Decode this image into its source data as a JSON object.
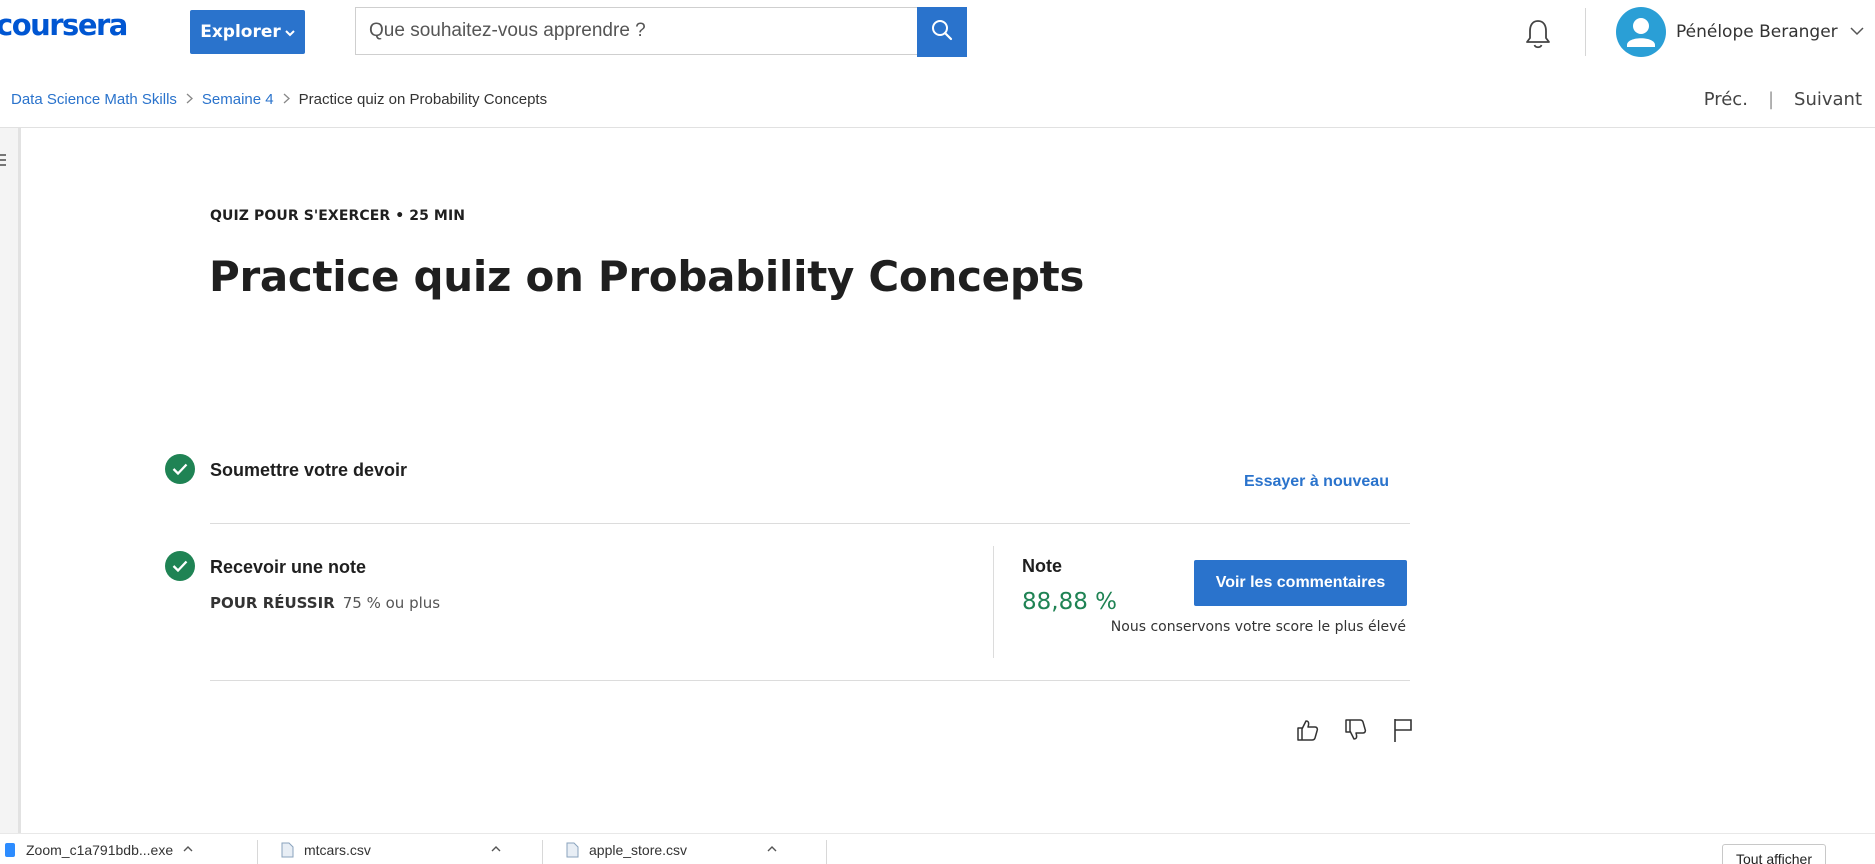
{
  "header": {
    "logo_text": "coursera",
    "explore_label": "Explorer",
    "search_placeholder": "Que souhaitez-vous apprendre ?",
    "user_name": "Pénélope Beranger"
  },
  "breadcrumb": {
    "items": [
      "Data Science Math Skills",
      "Semaine 4"
    ],
    "current": "Practice quiz on Probability Concepts"
  },
  "pager": {
    "prev": "Préc.",
    "next": "Suivant"
  },
  "quiz": {
    "eyebrow": "QUIZ POUR S'EXERCER • 25  MIN",
    "title": "Practice quiz on Probability Concepts",
    "submit_step": "Soumettre votre devoir",
    "retry_label": "Essayer à nouveau",
    "grade_step": "Recevoir une note",
    "pass_label": "POUR RÉUSSIR",
    "pass_value": "75 % ou plus",
    "grade_label": "Note",
    "grade_value": "88,88 %",
    "feedback_label": "Voir les commentaires",
    "score_note": "Nous conservons votre score le plus élevé"
  },
  "downloads": {
    "items": [
      "Zoom_c1a791bdb...exe",
      "mtcars.csv",
      "apple_store.csv"
    ],
    "show_all": "Tout afficher"
  },
  "colors": {
    "brand": "#0056d2",
    "button": "#2a73cc",
    "success": "#1f8354"
  }
}
